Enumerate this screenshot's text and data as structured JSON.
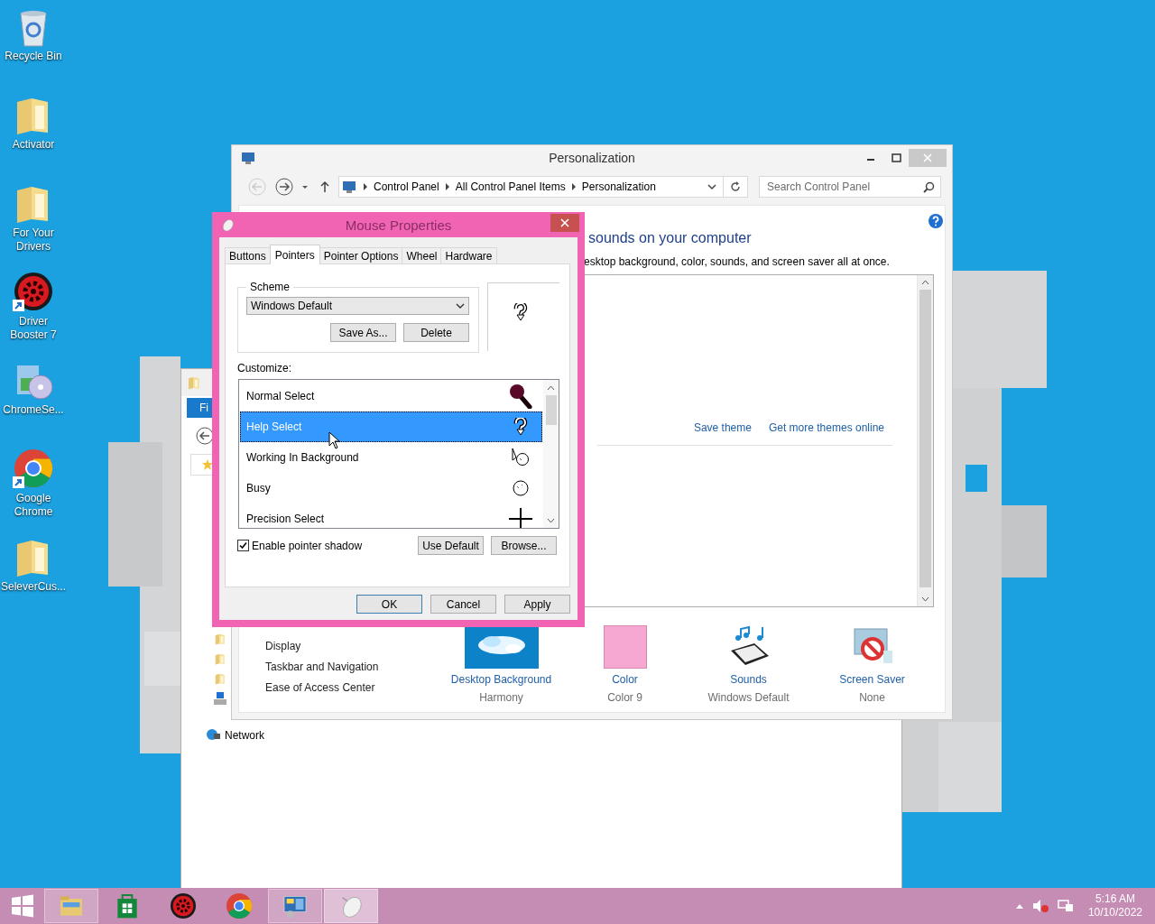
{
  "desktop_icons": [
    {
      "label": "Recycle Bin",
      "kind": "recycle"
    },
    {
      "label": "Activator",
      "kind": "folder"
    },
    {
      "label": "For Your Drivers",
      "kind": "folder"
    },
    {
      "label": "Driver Booster 7",
      "kind": "booster"
    },
    {
      "label": "ChromeSe...",
      "kind": "installer"
    },
    {
      "label": "Google Chrome",
      "kind": "chrome"
    },
    {
      "label": "SeleverCus...",
      "kind": "folder"
    }
  ],
  "explorer": {
    "ribbon_tab": "Fi",
    "network": "Network"
  },
  "personalization": {
    "title": "Personalization",
    "breadcrumb": [
      "Control Panel",
      "All Control Panel Items",
      "Personalization"
    ],
    "search": {
      "placeholder": "Search Control Panel"
    },
    "heading": "sounds on your computer",
    "description": "esktop background, color, sounds, and screen saver all at once.",
    "theme_links": [
      "Save theme",
      "Get more themes online"
    ],
    "see_also": [
      "Display",
      "Taskbar and Navigation",
      "Ease of Access Center"
    ],
    "settings": [
      {
        "kind": "background",
        "label": "Desktop Background",
        "value": "Harmony"
      },
      {
        "kind": "color",
        "label": "Color",
        "value": "Color 9"
      },
      {
        "kind": "sounds",
        "label": "Sounds",
        "value": "Windows Default"
      },
      {
        "kind": "screensaver",
        "label": "Screen Saver",
        "value": "None"
      }
    ]
  },
  "mouse_properties": {
    "title": "Mouse Properties",
    "tabs": [
      {
        "label": "Buttons",
        "selected": false
      },
      {
        "label": "Pointers",
        "selected": true
      },
      {
        "label": "Pointer Options",
        "selected": false
      },
      {
        "label": "Wheel",
        "selected": false
      },
      {
        "label": "Hardware",
        "selected": false
      }
    ],
    "scheme_label": "Scheme",
    "scheme": "Windows Default",
    "scheme_buttons": [
      "Save As...",
      "Delete"
    ],
    "customize_label": "Customize:",
    "pointers": [
      {
        "name": "Normal Select",
        "kind": "pin",
        "selected": false
      },
      {
        "name": "Help Select",
        "kind": "help",
        "selected": true
      },
      {
        "name": "Working In Background",
        "kind": "working",
        "selected": false
      },
      {
        "name": "Busy",
        "kind": "busy",
        "selected": false
      },
      {
        "name": "Precision Select",
        "kind": "cross",
        "selected": false
      }
    ],
    "shadow": {
      "label": "Enable pointer shadow",
      "checked": true
    },
    "pointer_buttons": [
      "Use Default",
      "Browse..."
    ],
    "buttons": [
      "OK",
      "Cancel",
      "Apply"
    ]
  },
  "taskbar": {
    "apps": [
      {
        "kind": "explorer",
        "running": true,
        "selected": false
      },
      {
        "kind": "store",
        "running": false,
        "selected": false
      },
      {
        "kind": "booster",
        "running": false,
        "selected": false
      },
      {
        "kind": "chrome",
        "running": false,
        "selected": false
      },
      {
        "kind": "controlpanel",
        "running": true,
        "selected": false
      },
      {
        "kind": "mouse",
        "running": true,
        "selected": true
      }
    ],
    "time": "5:16 AM",
    "date": "10/10/2022"
  }
}
